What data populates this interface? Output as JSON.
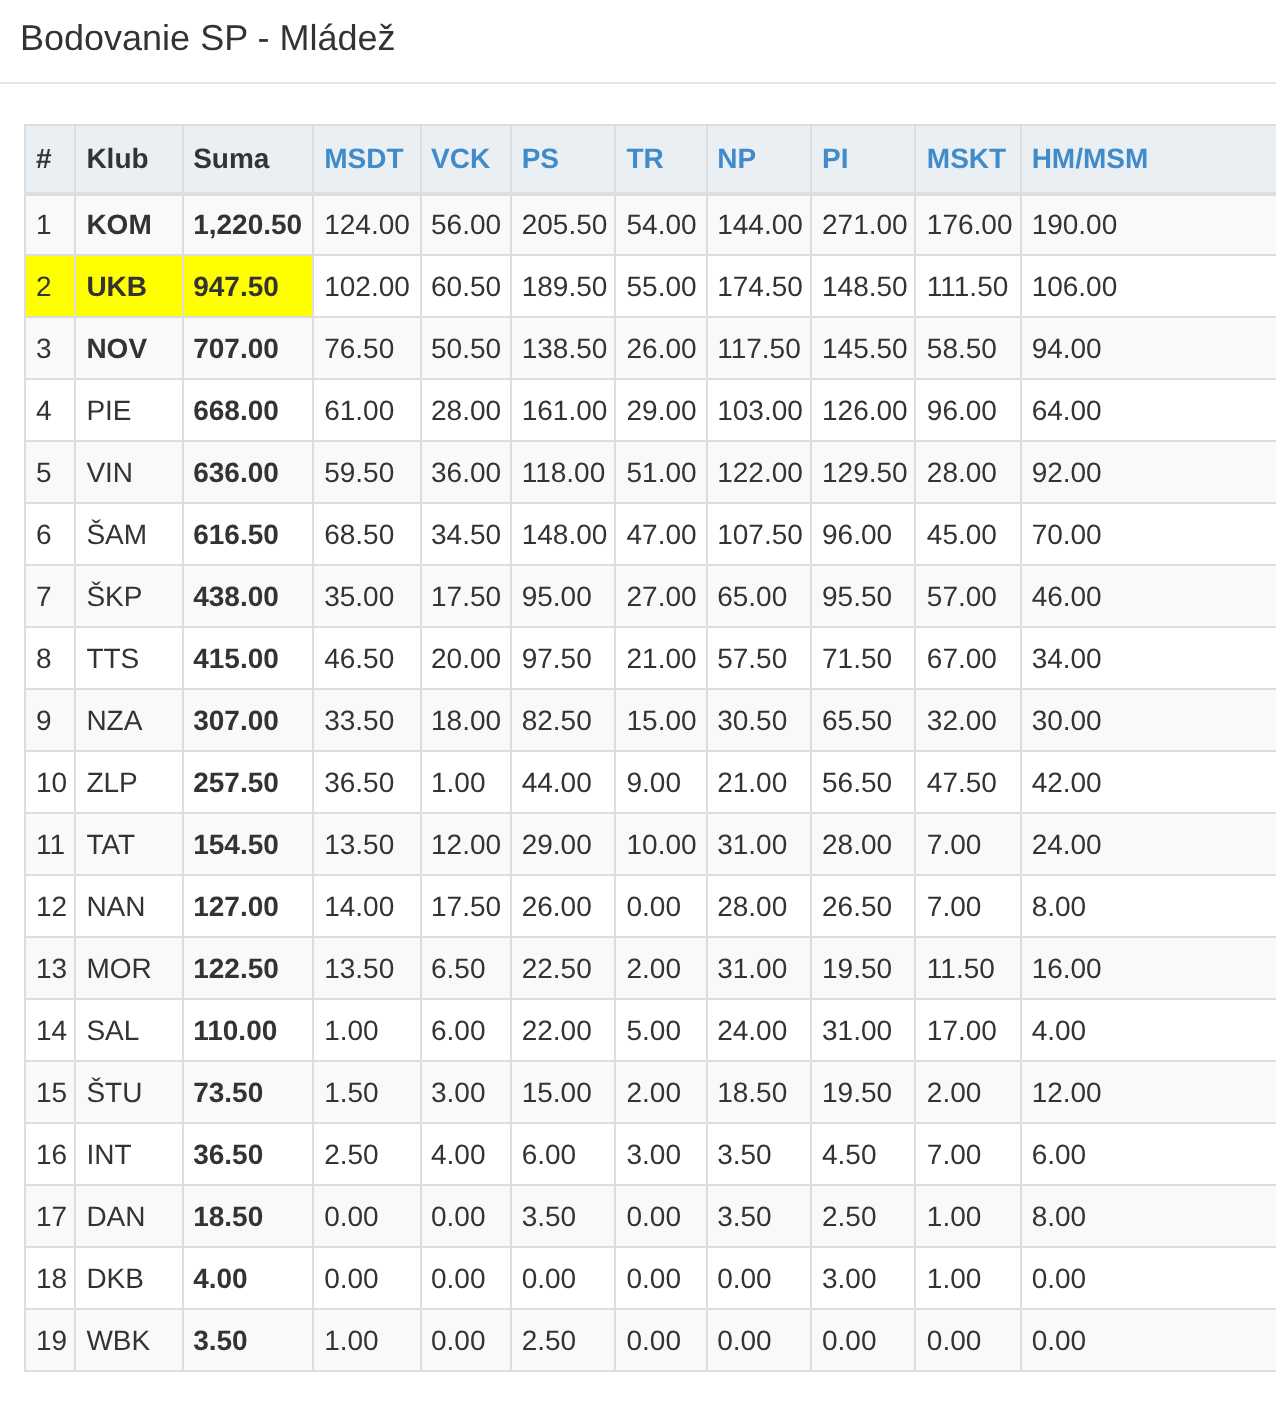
{
  "title": "Bodovanie SP - Mládež",
  "table": {
    "columns": [
      {
        "label": "#",
        "sortable": false
      },
      {
        "label": "Klub",
        "sortable": false
      },
      {
        "label": "Suma",
        "sortable": false
      },
      {
        "label": "MSDT",
        "sortable": true
      },
      {
        "label": "VCK",
        "sortable": true
      },
      {
        "label": "PS",
        "sortable": true
      },
      {
        "label": "TR",
        "sortable": true
      },
      {
        "label": "NP",
        "sortable": true
      },
      {
        "label": "PI",
        "sortable": true
      },
      {
        "label": "MSKT",
        "sortable": true
      },
      {
        "label": "HM/MSM",
        "sortable": true
      }
    ],
    "rows": [
      {
        "highlighted": false,
        "club_bold": true,
        "cells": [
          "1",
          "KOM",
          "1,220.50",
          "124.00",
          "56.00",
          "205.50",
          "54.00",
          "144.00",
          "271.00",
          "176.00",
          "190.00"
        ]
      },
      {
        "highlighted": true,
        "club_bold": true,
        "cells": [
          "2",
          "UKB",
          "947.50",
          "102.00",
          "60.50",
          "189.50",
          "55.00",
          "174.50",
          "148.50",
          "111.50",
          "106.00"
        ]
      },
      {
        "highlighted": false,
        "club_bold": true,
        "cells": [
          "3",
          "NOV",
          "707.00",
          "76.50",
          "50.50",
          "138.50",
          "26.00",
          "117.50",
          "145.50",
          "58.50",
          "94.00"
        ]
      },
      {
        "highlighted": false,
        "club_bold": false,
        "cells": [
          "4",
          "PIE",
          "668.00",
          "61.00",
          "28.00",
          "161.00",
          "29.00",
          "103.00",
          "126.00",
          "96.00",
          "64.00"
        ]
      },
      {
        "highlighted": false,
        "club_bold": false,
        "cells": [
          "5",
          "VIN",
          "636.00",
          "59.50",
          "36.00",
          "118.00",
          "51.00",
          "122.00",
          "129.50",
          "28.00",
          "92.00"
        ]
      },
      {
        "highlighted": false,
        "club_bold": false,
        "cells": [
          "6",
          "ŠAM",
          "616.50",
          "68.50",
          "34.50",
          "148.00",
          "47.00",
          "107.50",
          "96.00",
          "45.00",
          "70.00"
        ]
      },
      {
        "highlighted": false,
        "club_bold": false,
        "cells": [
          "7",
          "ŠKP",
          "438.00",
          "35.00",
          "17.50",
          "95.00",
          "27.00",
          "65.00",
          "95.50",
          "57.00",
          "46.00"
        ]
      },
      {
        "highlighted": false,
        "club_bold": false,
        "cells": [
          "8",
          "TTS",
          "415.00",
          "46.50",
          "20.00",
          "97.50",
          "21.00",
          "57.50",
          "71.50",
          "67.00",
          "34.00"
        ]
      },
      {
        "highlighted": false,
        "club_bold": false,
        "cells": [
          "9",
          "NZA",
          "307.00",
          "33.50",
          "18.00",
          "82.50",
          "15.00",
          "30.50",
          "65.50",
          "32.00",
          "30.00"
        ]
      },
      {
        "highlighted": false,
        "club_bold": false,
        "cells": [
          "10",
          "ZLP",
          "257.50",
          "36.50",
          "1.00",
          "44.00",
          "9.00",
          "21.00",
          "56.50",
          "47.50",
          "42.00"
        ]
      },
      {
        "highlighted": false,
        "club_bold": false,
        "cells": [
          "11",
          "TAT",
          "154.50",
          "13.50",
          "12.00",
          "29.00",
          "10.00",
          "31.00",
          "28.00",
          "7.00",
          "24.00"
        ]
      },
      {
        "highlighted": false,
        "club_bold": false,
        "cells": [
          "12",
          "NAN",
          "127.00",
          "14.00",
          "17.50",
          "26.00",
          "0.00",
          "28.00",
          "26.50",
          "7.00",
          "8.00"
        ]
      },
      {
        "highlighted": false,
        "club_bold": false,
        "cells": [
          "13",
          "MOR",
          "122.50",
          "13.50",
          "6.50",
          "22.50",
          "2.00",
          "31.00",
          "19.50",
          "11.50",
          "16.00"
        ]
      },
      {
        "highlighted": false,
        "club_bold": false,
        "cells": [
          "14",
          "SAL",
          "110.00",
          "1.00",
          "6.00",
          "22.00",
          "5.00",
          "24.00",
          "31.00",
          "17.00",
          "4.00"
        ]
      },
      {
        "highlighted": false,
        "club_bold": false,
        "cells": [
          "15",
          "ŠTU",
          "73.50",
          "1.50",
          "3.00",
          "15.00",
          "2.00",
          "18.50",
          "19.50",
          "2.00",
          "12.00"
        ]
      },
      {
        "highlighted": false,
        "club_bold": false,
        "cells": [
          "16",
          "INT",
          "36.50",
          "2.50",
          "4.00",
          "6.00",
          "3.00",
          "3.50",
          "4.50",
          "7.00",
          "6.00"
        ]
      },
      {
        "highlighted": false,
        "club_bold": false,
        "cells": [
          "17",
          "DAN",
          "18.50",
          "0.00",
          "0.00",
          "3.50",
          "0.00",
          "3.50",
          "2.50",
          "1.00",
          "8.00"
        ]
      },
      {
        "highlighted": false,
        "club_bold": false,
        "cells": [
          "18",
          "DKB",
          "4.00",
          "0.00",
          "0.00",
          "0.00",
          "0.00",
          "0.00",
          "3.00",
          "1.00",
          "0.00"
        ]
      },
      {
        "highlighted": false,
        "club_bold": false,
        "cells": [
          "19",
          "WBK",
          "3.50",
          "1.00",
          "0.00",
          "2.50",
          "0.00",
          "0.00",
          "0.00",
          "0.00",
          "0.00"
        ]
      }
    ]
  }
}
